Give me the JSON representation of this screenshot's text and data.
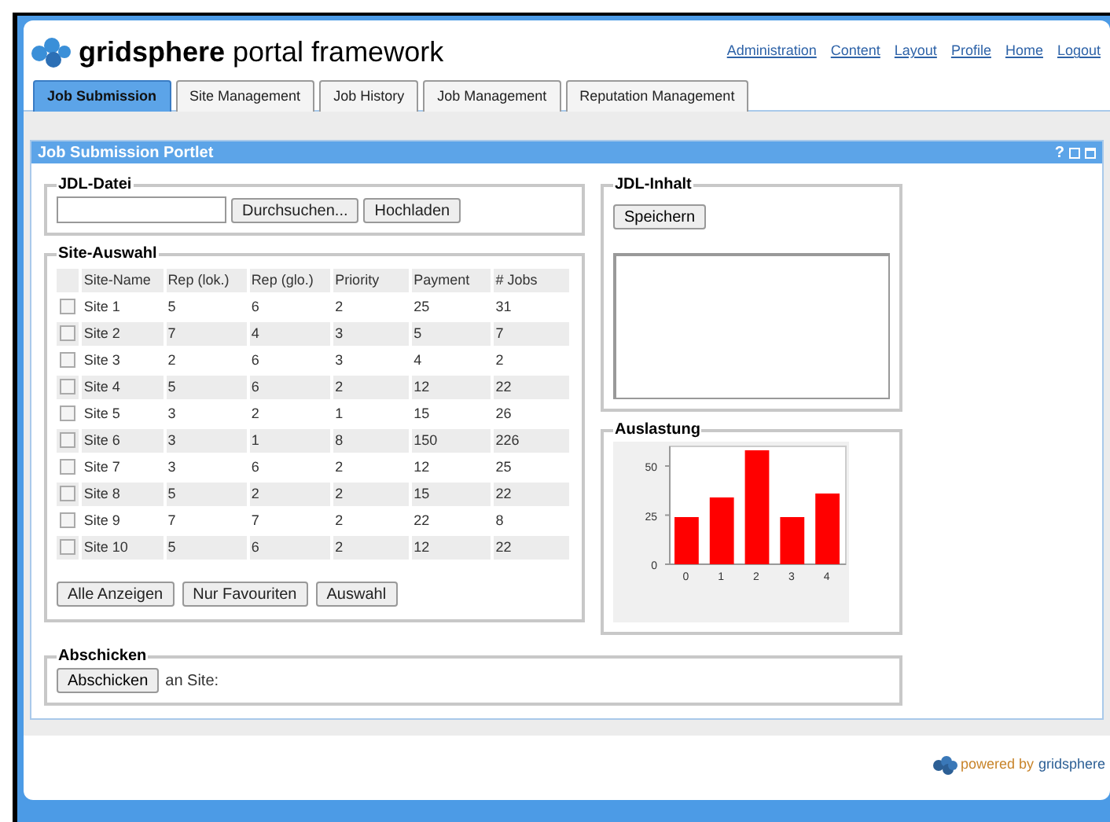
{
  "header": {
    "brand_bold": "gridsphere",
    "brand_rest": "portal framework",
    "links": [
      "Administration",
      "Content",
      "Layout",
      "Profile",
      "Home",
      "Logout"
    ]
  },
  "tabs": [
    {
      "label": "Job Submission",
      "selected": true
    },
    {
      "label": "Site Management",
      "selected": false
    },
    {
      "label": "Job History",
      "selected": false
    },
    {
      "label": "Job Management",
      "selected": false
    },
    {
      "label": "Reputation Management",
      "selected": false
    }
  ],
  "portlet": {
    "title": "Job Submission Portlet",
    "controls": [
      "?"
    ]
  },
  "jdl_datei": {
    "legend": "JDL-Datei",
    "buttons": [
      "Durchsuchen...",
      "Hochladen"
    ]
  },
  "site_auswahl": {
    "legend": "Site-Auswahl",
    "columns": [
      "Site-Name",
      "Rep (lok.)",
      "Rep (glo.)",
      "Priority",
      "Payment",
      "# Jobs"
    ],
    "rows": [
      {
        "checked": false,
        "cells": [
          "Site 1",
          "5",
          "6",
          "2",
          "25",
          "31"
        ]
      },
      {
        "checked": false,
        "cells": [
          "Site 2",
          "7",
          "4",
          "3",
          "5",
          "7"
        ]
      },
      {
        "checked": false,
        "cells": [
          "Site 3",
          "2",
          "6",
          "3",
          "4",
          "2"
        ]
      },
      {
        "checked": false,
        "cells": [
          "Site 4",
          "5",
          "6",
          "2",
          "12",
          "22"
        ]
      },
      {
        "checked": false,
        "cells": [
          "Site 5",
          "3",
          "2",
          "1",
          "15",
          "26"
        ]
      },
      {
        "checked": false,
        "cells": [
          "Site 6",
          "3",
          "1",
          "8",
          "150",
          "226"
        ]
      },
      {
        "checked": false,
        "cells": [
          "Site 7",
          "3",
          "6",
          "2",
          "12",
          "25"
        ]
      },
      {
        "checked": false,
        "cells": [
          "Site 8",
          "5",
          "2",
          "2",
          "15",
          "22"
        ]
      },
      {
        "checked": false,
        "cells": [
          "Site 9",
          "7",
          "7",
          "2",
          "22",
          "8"
        ]
      },
      {
        "checked": false,
        "cells": [
          "Site 10",
          "5",
          "6",
          "2",
          "12",
          "22"
        ]
      }
    ],
    "buttons": [
      "Alle Anzeigen",
      "Nur Favouriten",
      "Auswahl"
    ]
  },
  "jdl_inhalt": {
    "legend": "JDL-Inhalt",
    "button": "Speichern"
  },
  "auslastung": {
    "legend": "Auslastung",
    "chart_data": {
      "type": "bar",
      "categories": [
        "0",
        "1",
        "2",
        "3",
        "4"
      ],
      "series": [
        {
          "color": "#ff0000",
          "values": [
            24,
            34,
            58,
            24,
            36
          ]
        }
      ],
      "ylim": [
        0,
        60
      ],
      "yticks": [
        0,
        25,
        50
      ]
    }
  },
  "abschicken": {
    "legend": "Abschicken",
    "button": "Abschicken",
    "label": "an Site:"
  },
  "footer": {
    "powered": "powered by",
    "brand": "gridsphere"
  }
}
